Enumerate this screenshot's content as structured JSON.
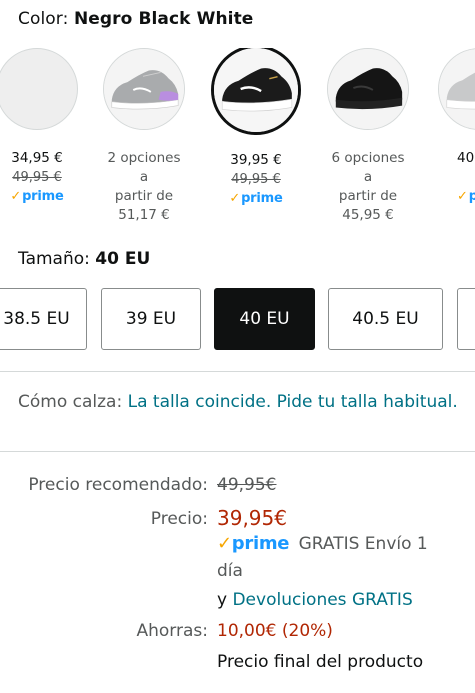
{
  "color": {
    "label": "Color:",
    "value": "Negro Black White"
  },
  "swatches": [
    {
      "price": "34,95 €",
      "was": "49,95 €",
      "prime": "prime"
    },
    {
      "line1": "2 opciones a",
      "line2": "partir de",
      "line3": "51,17 €"
    },
    {
      "price": "39,95 €",
      "was": "49,95 €",
      "prime": "prime"
    },
    {
      "line1": "6 opciones a",
      "line2": "partir de",
      "line3": "45,95 €"
    },
    {
      "price": "40,",
      "prime": "p"
    }
  ],
  "size": {
    "label": "Tamaño:",
    "value": "40 EU",
    "options": [
      "38.5 EU",
      "39 EU",
      "40 EU",
      "40.5 EU"
    ]
  },
  "fit": {
    "label": "Cómo calza:",
    "link": "La talla coincide. Pide tu talla habitual."
  },
  "pricing": {
    "list_label": "Precio recomendado:",
    "list_value": "49,95€",
    "price_label": "Precio:",
    "price_value": "39,95€",
    "prime": "prime",
    "shipping": "GRATIS Envío 1",
    "shipping2": "día",
    "returns_prefix": "y",
    "returns_link": "Devoluciones GRATIS",
    "savings_label": "Ahorras:",
    "savings_value": "10,00€ (20%)",
    "final_note": "Precio final del producto"
  },
  "colors": {
    "link": "#007185",
    "price": "#b12704",
    "prime": "#1a98ff",
    "prime_check": "#f7a600"
  }
}
